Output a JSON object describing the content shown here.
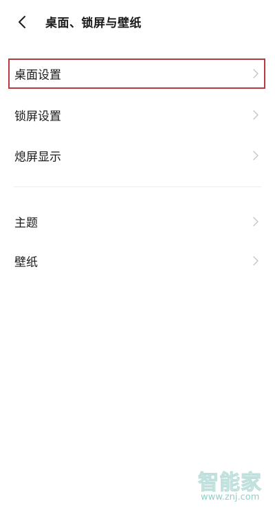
{
  "header": {
    "title": "桌面、锁屏与壁纸",
    "back_icon": "chevron-left-icon"
  },
  "settings": {
    "items": [
      {
        "label": "桌面设置",
        "highlighted": true
      },
      {
        "label": "锁屏设置"
      },
      {
        "label": "熄屏显示"
      },
      {
        "label": "主题"
      },
      {
        "label": "壁纸"
      }
    ],
    "chevron_icon": "chevron-right-icon"
  },
  "watermark": {
    "name": "智能家",
    "url": "www.znj.com"
  },
  "colors": {
    "highlight_border": "#b7383d",
    "chevron": "#c4c4c4",
    "divider": "#ececec",
    "watermark": "#8fd0c9"
  }
}
